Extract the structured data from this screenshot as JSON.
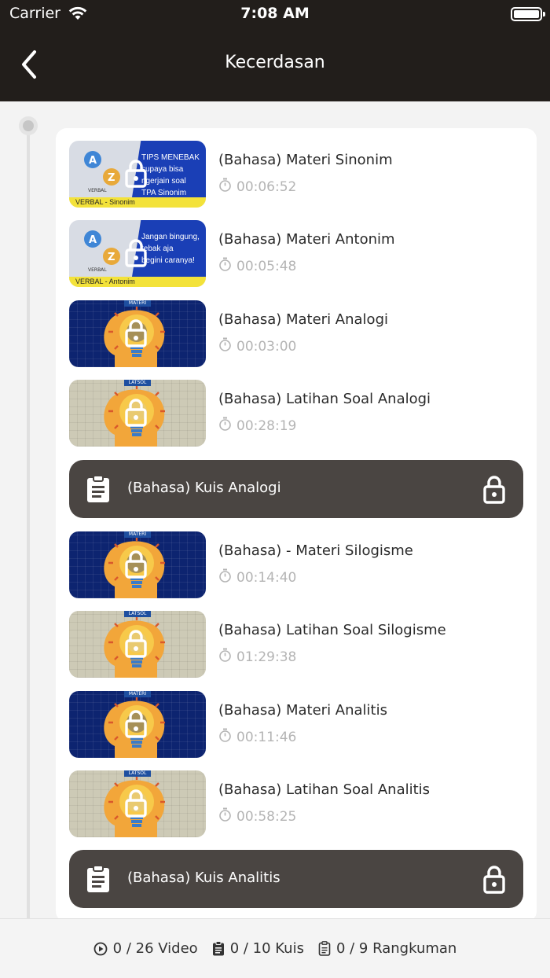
{
  "status_bar": {
    "carrier": "Carrier",
    "time": "7:08 AM"
  },
  "header": {
    "title": "Kecerdasan"
  },
  "items": [
    {
      "title": "(Bahasa) Materi Sinonim",
      "duration": "00:06:52",
      "thumb": {
        "style": "verbal",
        "lines": [
          "TIPS MENEBAK",
          "supaya bisa",
          "ngerjain soal",
          "TPA Sinonim"
        ],
        "tag": "VERBAL - Sinonim"
      }
    },
    {
      "title": "(Bahasa) Materi Antonim",
      "duration": "00:05:48",
      "thumb": {
        "style": "verbal",
        "lines": [
          "Jangan bingung,",
          "tebak aja",
          "begini caranya!"
        ],
        "tag": "VERBAL - Antonim"
      }
    },
    {
      "title": "(Bahasa) Materi Analogi",
      "duration": "00:03:00",
      "thumb": {
        "style": "materi",
        "tag": "MATERI"
      }
    },
    {
      "title": "(Bahasa) Latihan Soal Analogi",
      "duration": "00:28:19",
      "thumb": {
        "style": "latsol",
        "tag": "LATSOL"
      }
    },
    {
      "title": "(Bahasa) - Materi Silogisme",
      "duration": "00:14:40",
      "thumb": {
        "style": "materi",
        "tag": "MATERI"
      }
    },
    {
      "title": "(Bahasa) Latihan Soal Silogisme",
      "duration": "01:29:38",
      "thumb": {
        "style": "latsol",
        "tag": "LATSOL"
      }
    },
    {
      "title": "(Bahasa) Materi Analitis",
      "duration": "00:11:46",
      "thumb": {
        "style": "materi",
        "tag": "MATERI"
      }
    },
    {
      "title": "(Bahasa) Latihan Soal Analitis",
      "duration": "00:58:25",
      "thumb": {
        "style": "latsol",
        "tag": "LATSOL"
      }
    }
  ],
  "quizzes": [
    {
      "title": "(Bahasa) Kuis Analogi"
    },
    {
      "title": "(Bahasa) Kuis Analitis"
    }
  ],
  "footer": {
    "video": "0 / 26 Video",
    "kuis": "0 / 10 Kuis",
    "rangkuman": "0 / 9 Rangkuman"
  },
  "colors": {
    "bar": "#221e1b",
    "quiz_bg": "#4a4542",
    "muted": "#b4b4b4"
  }
}
